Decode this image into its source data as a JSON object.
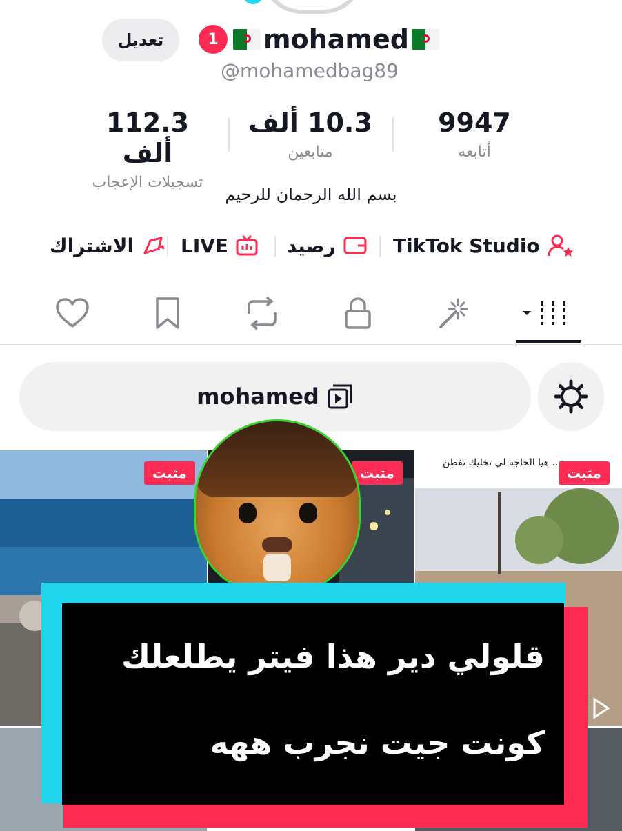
{
  "profile": {
    "edit_label": "تعديل",
    "notification_count": "1",
    "display_name": "mohamed",
    "handle": "@mohamedbag89",
    "bio": "بسم الله الرحمان للرحيم"
  },
  "stats": {
    "likes": {
      "value": "112.3 ألف",
      "label": "تسجيلات الإعجاب"
    },
    "followers": {
      "value": "10.3 ألف",
      "label": "متابعين"
    },
    "following": {
      "value": "9947",
      "label": "أتابعه"
    }
  },
  "quick_links": {
    "subscription": "الاشتراك",
    "live": "LIVE",
    "balance": "رصيد",
    "studio": "TikTok Studio"
  },
  "tabs": [
    "likes-tab",
    "favorites-tab",
    "reposts-tab",
    "private-tab",
    "creations-tab",
    "videos-tab"
  ],
  "playlist": {
    "label": "mohamed"
  },
  "pinned_label": "مثبت",
  "overlay_caption": {
    "line1": "قلولي دير هذا فيتر يطلعلك",
    "line2": "كونت جيت نجرب ههه"
  },
  "thumb_text": "... هيا الحاجة لي تخليك تفطن",
  "colors": {
    "accent": "#fe2c55",
    "cyan": "#20d5ec",
    "text": "#161823",
    "muted": "#8a8b91"
  }
}
